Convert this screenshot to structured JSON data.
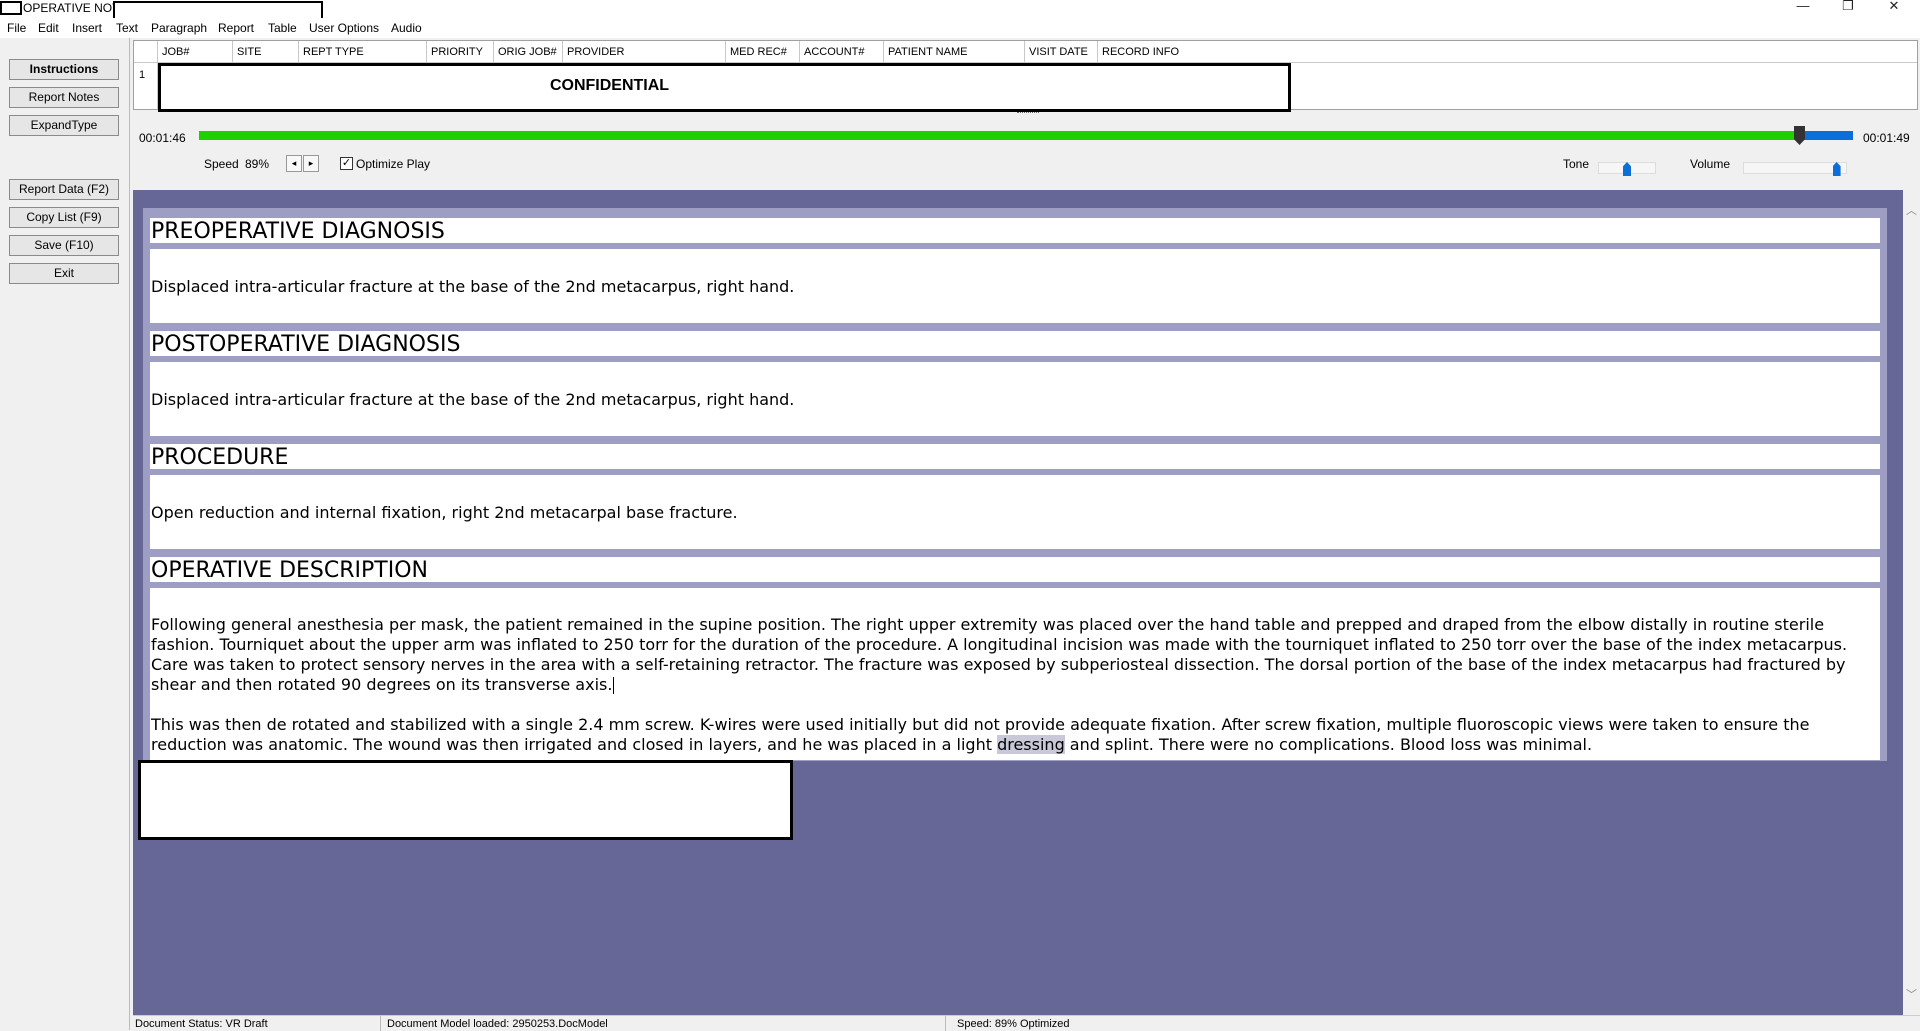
{
  "window": {
    "title": "OPERATIVE NOTE",
    "minimize": "—",
    "restore": "❐",
    "close": "✕"
  },
  "menu": [
    "File",
    "Edit",
    "Insert",
    "Text",
    "Paragraph",
    "Report",
    "Table",
    "User Options",
    "Audio"
  ],
  "left_buttons": {
    "instructions": "Instructions",
    "report_notes": "Report Notes",
    "expand_type": "ExpandType",
    "report_data": "Report Data (F2)",
    "copy_list": "Copy List (F9)",
    "save": "Save (F10)",
    "exit": "Exit"
  },
  "grid": {
    "columns": [
      "JOB#",
      "SITE",
      "REPT TYPE",
      "PRIORITY",
      "ORIG JOB#",
      "PROVIDER",
      "MED REC#",
      "ACCOUNT#",
      "PATIENT NAME",
      "VISIT DATE",
      "RECORD INFO"
    ],
    "row_number": "1",
    "overlay_text": "CONFIDENTIAL"
  },
  "audio": {
    "elapsed": "00:01:46",
    "total": "00:01:49",
    "progress_fraction": 0.968,
    "speed_label": "Speed",
    "speed_value": "89%",
    "spin_down": "◂",
    "spin_up": "▸",
    "optimize_label": "Optimize Play",
    "optimize_checked": true,
    "tone_label": "Tone",
    "tone_level": 0.5,
    "volume_label": "Volume",
    "volume_level": 0.9
  },
  "document": {
    "pre_dx_heading": "PREOPERATIVE DIAGNOSIS",
    "pre_dx_text": "Displaced intra-articular fracture at the base of the 2nd metacarpus, right hand.",
    "post_dx_heading": "POSTOPERATIVE DIAGNOSIS",
    "post_dx_text": "Displaced intra-articular fracture at the base of the 2nd metacarpus, right hand.",
    "procedure_heading": "PROCEDURE",
    "procedure_text": "Open reduction and internal fixation, right 2nd metacarpal base fracture.",
    "op_desc_heading": "OPERATIVE DESCRIPTION",
    "op_desc_p1": "Following general anesthesia per mask, the patient remained in the supine position.  The right upper extremity was placed over the hand table and prepped and draped from the elbow distally in routine sterile fashion.  Tourniquet about the upper arm was inflated to 250 torr for the duration of the procedure.  A longitudinal incision was made with the tourniquet inflated to 250 torr over the base of the index metacarpus.  Care was taken to protect sensory nerves in the area with a self-retaining retractor.  The fracture was exposed by subperiosteal dissection.  The dorsal portion of the base of the index metacarpus had fractured by shear and then rotated 90 degrees on its transverse axis.",
    "op_desc_p2_before": "This was then de rotated and stabilized with a single 2.4 mm screw.  K-wires were used initially but did not provide adequate fixation.  After screw fixation, multiple fluoroscopic views were taken to ensure the reduction was anatomic.  The wound was then irrigated and closed in layers, and he was placed in a light ",
    "op_desc_p2_highlight": "dressing",
    "op_desc_p2_after": " and splint.  There were no complications.  Blood loss was minimal."
  },
  "status": {
    "doc_status": "Document Status: VR Draft",
    "model": "Document Model loaded: 2950253.DocModel",
    "speed": "Speed: 89% Optimized"
  },
  "colors": {
    "progress_played": "#1ed000",
    "progress_remaining": "#0a6fd6",
    "editor_bg": "#676797",
    "section_border": "#9e9ec4"
  }
}
